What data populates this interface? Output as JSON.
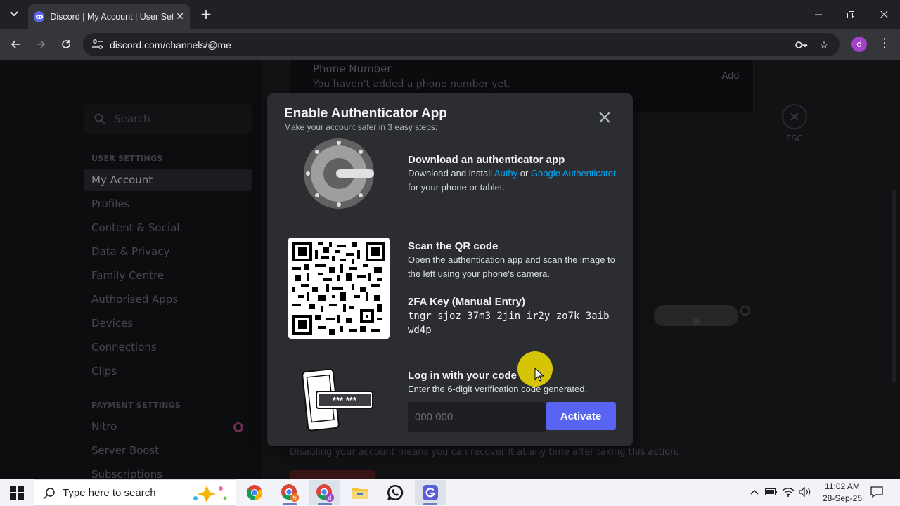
{
  "browser": {
    "tab_title": "Discord | My Account | User Settings",
    "url": "discord.com/channels/@me",
    "profile_initial": "d"
  },
  "sidebar": {
    "search_placeholder": "Search",
    "user_settings_header": "USER SETTINGS",
    "user_items": [
      "My Account",
      "Profiles",
      "Content & Social",
      "Data & Privacy",
      "Family Centre",
      "Authorised Apps",
      "Devices",
      "Connections",
      "Clips"
    ],
    "payment_header": "PAYMENT SETTINGS",
    "payment_items": [
      "Nitro",
      "Server Boost",
      "Subscriptions"
    ]
  },
  "content": {
    "phone_label": "Phone Number",
    "phone_sub": "You haven't added a phone number yet.",
    "add_label": "Add",
    "esc_label": "ESC",
    "disable_text": "Disabling your account means you can recover it at any time after taking this action."
  },
  "modal": {
    "title": "Enable Authenticator App",
    "subtitle": "Make your account safer in 3 easy steps:",
    "step1": {
      "title": "Download an authenticator app",
      "text_before": "Download and install ",
      "link1": "Authy",
      "text_mid": " or ",
      "link2": "Google Authenticator",
      "text_after": " for your phone or tablet."
    },
    "step2": {
      "title": "Scan the QR code",
      "text": "Open the authentication app and scan the image to the left using your phone's camera.",
      "key_title": "2FA Key (Manual Entry)",
      "key": "tngr sjoz 37m3 2jin ir2y zo7k 3aib wd4p"
    },
    "step3": {
      "title": "Log in with your code",
      "text": "Enter the 6-digit verification code generated.",
      "input_placeholder": "000 000",
      "button": "Activate",
      "phone_art_code": "*** ***"
    }
  },
  "taskbar": {
    "search_placeholder": "Type here to search",
    "time": "11:02 AM",
    "date": "28-Sep-25"
  },
  "colors": {
    "blurple": "#5865f2",
    "link": "#00a8fc",
    "modal_bg": "#2b2d31"
  }
}
